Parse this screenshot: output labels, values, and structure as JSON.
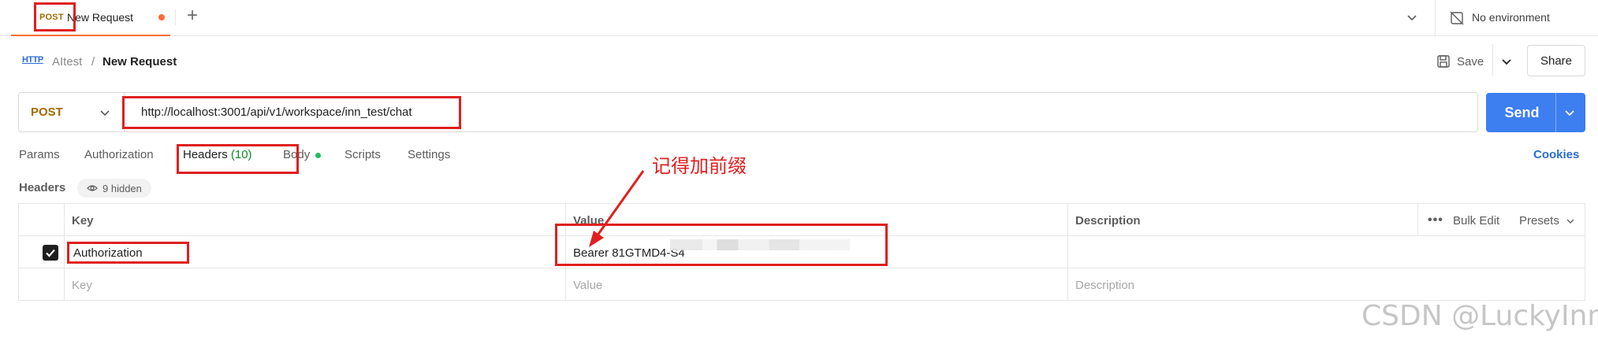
{
  "tab": {
    "method": "POST",
    "name": "New Request"
  },
  "environment": {
    "label": "No environment"
  },
  "breadcrumb": {
    "icon_text": "HTTP",
    "parent": "AItest",
    "separator": "/",
    "current": "New Request"
  },
  "toolbar": {
    "save_label": "Save",
    "share_label": "Share"
  },
  "request": {
    "method": "POST",
    "url": "http://localhost:3001/api/v1/workspace/inn_test/chat",
    "send_label": "Send"
  },
  "req_tabs": [
    {
      "label": "Params"
    },
    {
      "label": "Authorization"
    },
    {
      "label": "Headers",
      "count": "(10)"
    },
    {
      "label": "Body"
    },
    {
      "label": "Scripts"
    },
    {
      "label": "Settings"
    }
  ],
  "cookies_label": "Cookies",
  "headers_section": {
    "title": "Headers",
    "hidden_label": "9 hidden"
  },
  "table": {
    "columns": [
      "Key",
      "Value",
      "Description"
    ],
    "actions": {
      "more": "•••",
      "bulk_edit": "Bulk Edit",
      "presets": "Presets"
    },
    "rows": [
      {
        "checked": true,
        "key": "Authorization",
        "value": "Bearer 81GTMD4-S4",
        "description": ""
      }
    ],
    "placeholders": {
      "key": "Key",
      "value": "Value",
      "description": "Description"
    }
  },
  "annotation": {
    "text": "记得加前缀",
    "color": "#e01f1f"
  },
  "watermark": "CSDN @LuckyInn",
  "colors": {
    "accent": "#ff6c37",
    "send": "#3d7ef0",
    "post_method": "#a26b00",
    "link": "#2b6bd4",
    "count_green": "#108a28"
  }
}
